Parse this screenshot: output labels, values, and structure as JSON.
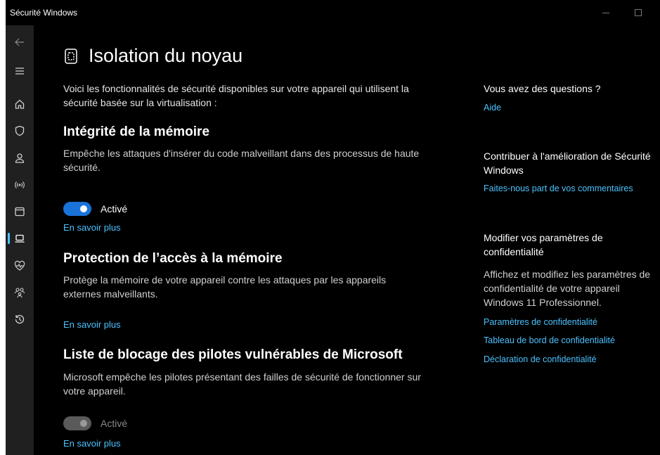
{
  "window": {
    "title": "Sécurité Windows"
  },
  "icons": {
    "back": "back-arrow-icon",
    "menu": "hamburger-menu-icon",
    "home": "home-icon",
    "virus": "shield-icon",
    "account": "person-icon",
    "firewall": "wifi-antenna-icon",
    "app": "browser-window-icon",
    "device": "laptop-icon",
    "health": "heart-pulse-icon",
    "family": "family-icon",
    "history": "history-icon",
    "core_isolation": "chip-icon"
  },
  "colors": {
    "accent": "#4cc2ff",
    "toggle_on": "#1a73d9",
    "background": "#000000"
  },
  "page": {
    "title": "Isolation du noyau",
    "intro": "Voici les fonctionnalités de sécurité disponibles sur votre appareil qui utilisent la sécurité basée sur la virtualisation :"
  },
  "sections": [
    {
      "title": "Intégrité de la mémoire",
      "description": "Empêche les attaques d'insérer du code malveillant dans des processus de haute sécurité.",
      "toggle_label": "Activé",
      "toggle_state": "on",
      "link": "En savoir plus"
    },
    {
      "title": "Protection de l’accès à la mémoire",
      "description": "Protège la mémoire de votre appareil contre les attaques par les appareils externes malveillants.",
      "link": "En savoir plus"
    },
    {
      "title": "Liste de blocage des pilotes vulnérables de Microsoft",
      "description": "Microsoft empêche les pilotes présentant des failles de sécurité de fonctionner sur votre appareil.",
      "toggle_label": "Activé",
      "toggle_state": "on-disabled",
      "link": "En savoir plus"
    }
  ],
  "aside": {
    "questions_heading": "Vous avez des questions ?",
    "help_link": "Aide",
    "contribute_heading": "Contribuer à l'amélioration de Sécurité Windows",
    "feedback_link": "Faites-nous part de vos commentaires",
    "privacy_heading": "Modifier vos paramètres de confidentialité",
    "privacy_text": "Affichez et modifiez les paramètres de confidentialité de votre appareil Windows 11 Professionnel.",
    "privacy_links": [
      "Paramètres de confidentialité",
      "Tableau de bord de confidentialité",
      "Déclaration de confidentialité"
    ]
  }
}
